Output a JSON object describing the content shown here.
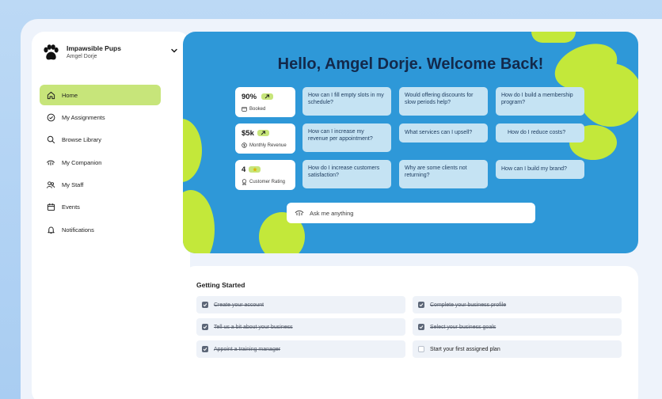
{
  "brand": {
    "name": "Impawsible Pups",
    "user": "Amgel Dorje"
  },
  "nav": [
    {
      "label": "Home",
      "icon": "home-icon",
      "active": true
    },
    {
      "label": "My Assignments",
      "icon": "check-circle-icon"
    },
    {
      "label": "Browse Library",
      "icon": "search-icon"
    },
    {
      "label": "My Companion",
      "icon": "companion-icon"
    },
    {
      "label": "My Staff",
      "icon": "staff-icon"
    },
    {
      "label": "Events",
      "icon": "calendar-icon"
    },
    {
      "label": "Notifications",
      "icon": "bell-icon"
    }
  ],
  "hero": {
    "greeting": "Hello, Amgel Dorje. Welcome Back!",
    "stats": [
      {
        "value": "90%",
        "label": "Booked",
        "icon": "calendar-icon",
        "badge": "arrow-up-right-icon"
      },
      {
        "value": "$5k",
        "label": "Monthly Revenue",
        "icon": "dollar-icon",
        "badge": "arrow-up-right-icon"
      },
      {
        "value": "4",
        "label": "Customer Rating",
        "icon": "award-icon",
        "badge": "star-icon"
      }
    ],
    "questions": [
      "How can I fill empty slots in my schedule?",
      "Would offering discounts for slow periods help?",
      "How do I build a membership program?",
      "How can I increase my revenue per appointment?",
      "What services can I upsell?",
      "How do I reduce costs?",
      "How do I increase customers satisfaction?",
      "Why are some clients not returning?",
      "How can I build my brand?"
    ],
    "ask_placeholder": "Ask me anything"
  },
  "getting_started": {
    "title": "Getting Started",
    "tasks": [
      {
        "label": "Create your account",
        "done": true
      },
      {
        "label": "Complete your business profile",
        "done": true
      },
      {
        "label": "Tell us a bit about your business",
        "done": true
      },
      {
        "label": "Select your business goals",
        "done": true
      },
      {
        "label": "Appoint a training manager",
        "done": true
      },
      {
        "label": "Start your first assigned plan",
        "done": false
      }
    ]
  },
  "colors": {
    "accent": "#c7e57a",
    "hero_bg": "#2e98d8",
    "blob": "#c3e83a",
    "title": "#13294b"
  }
}
